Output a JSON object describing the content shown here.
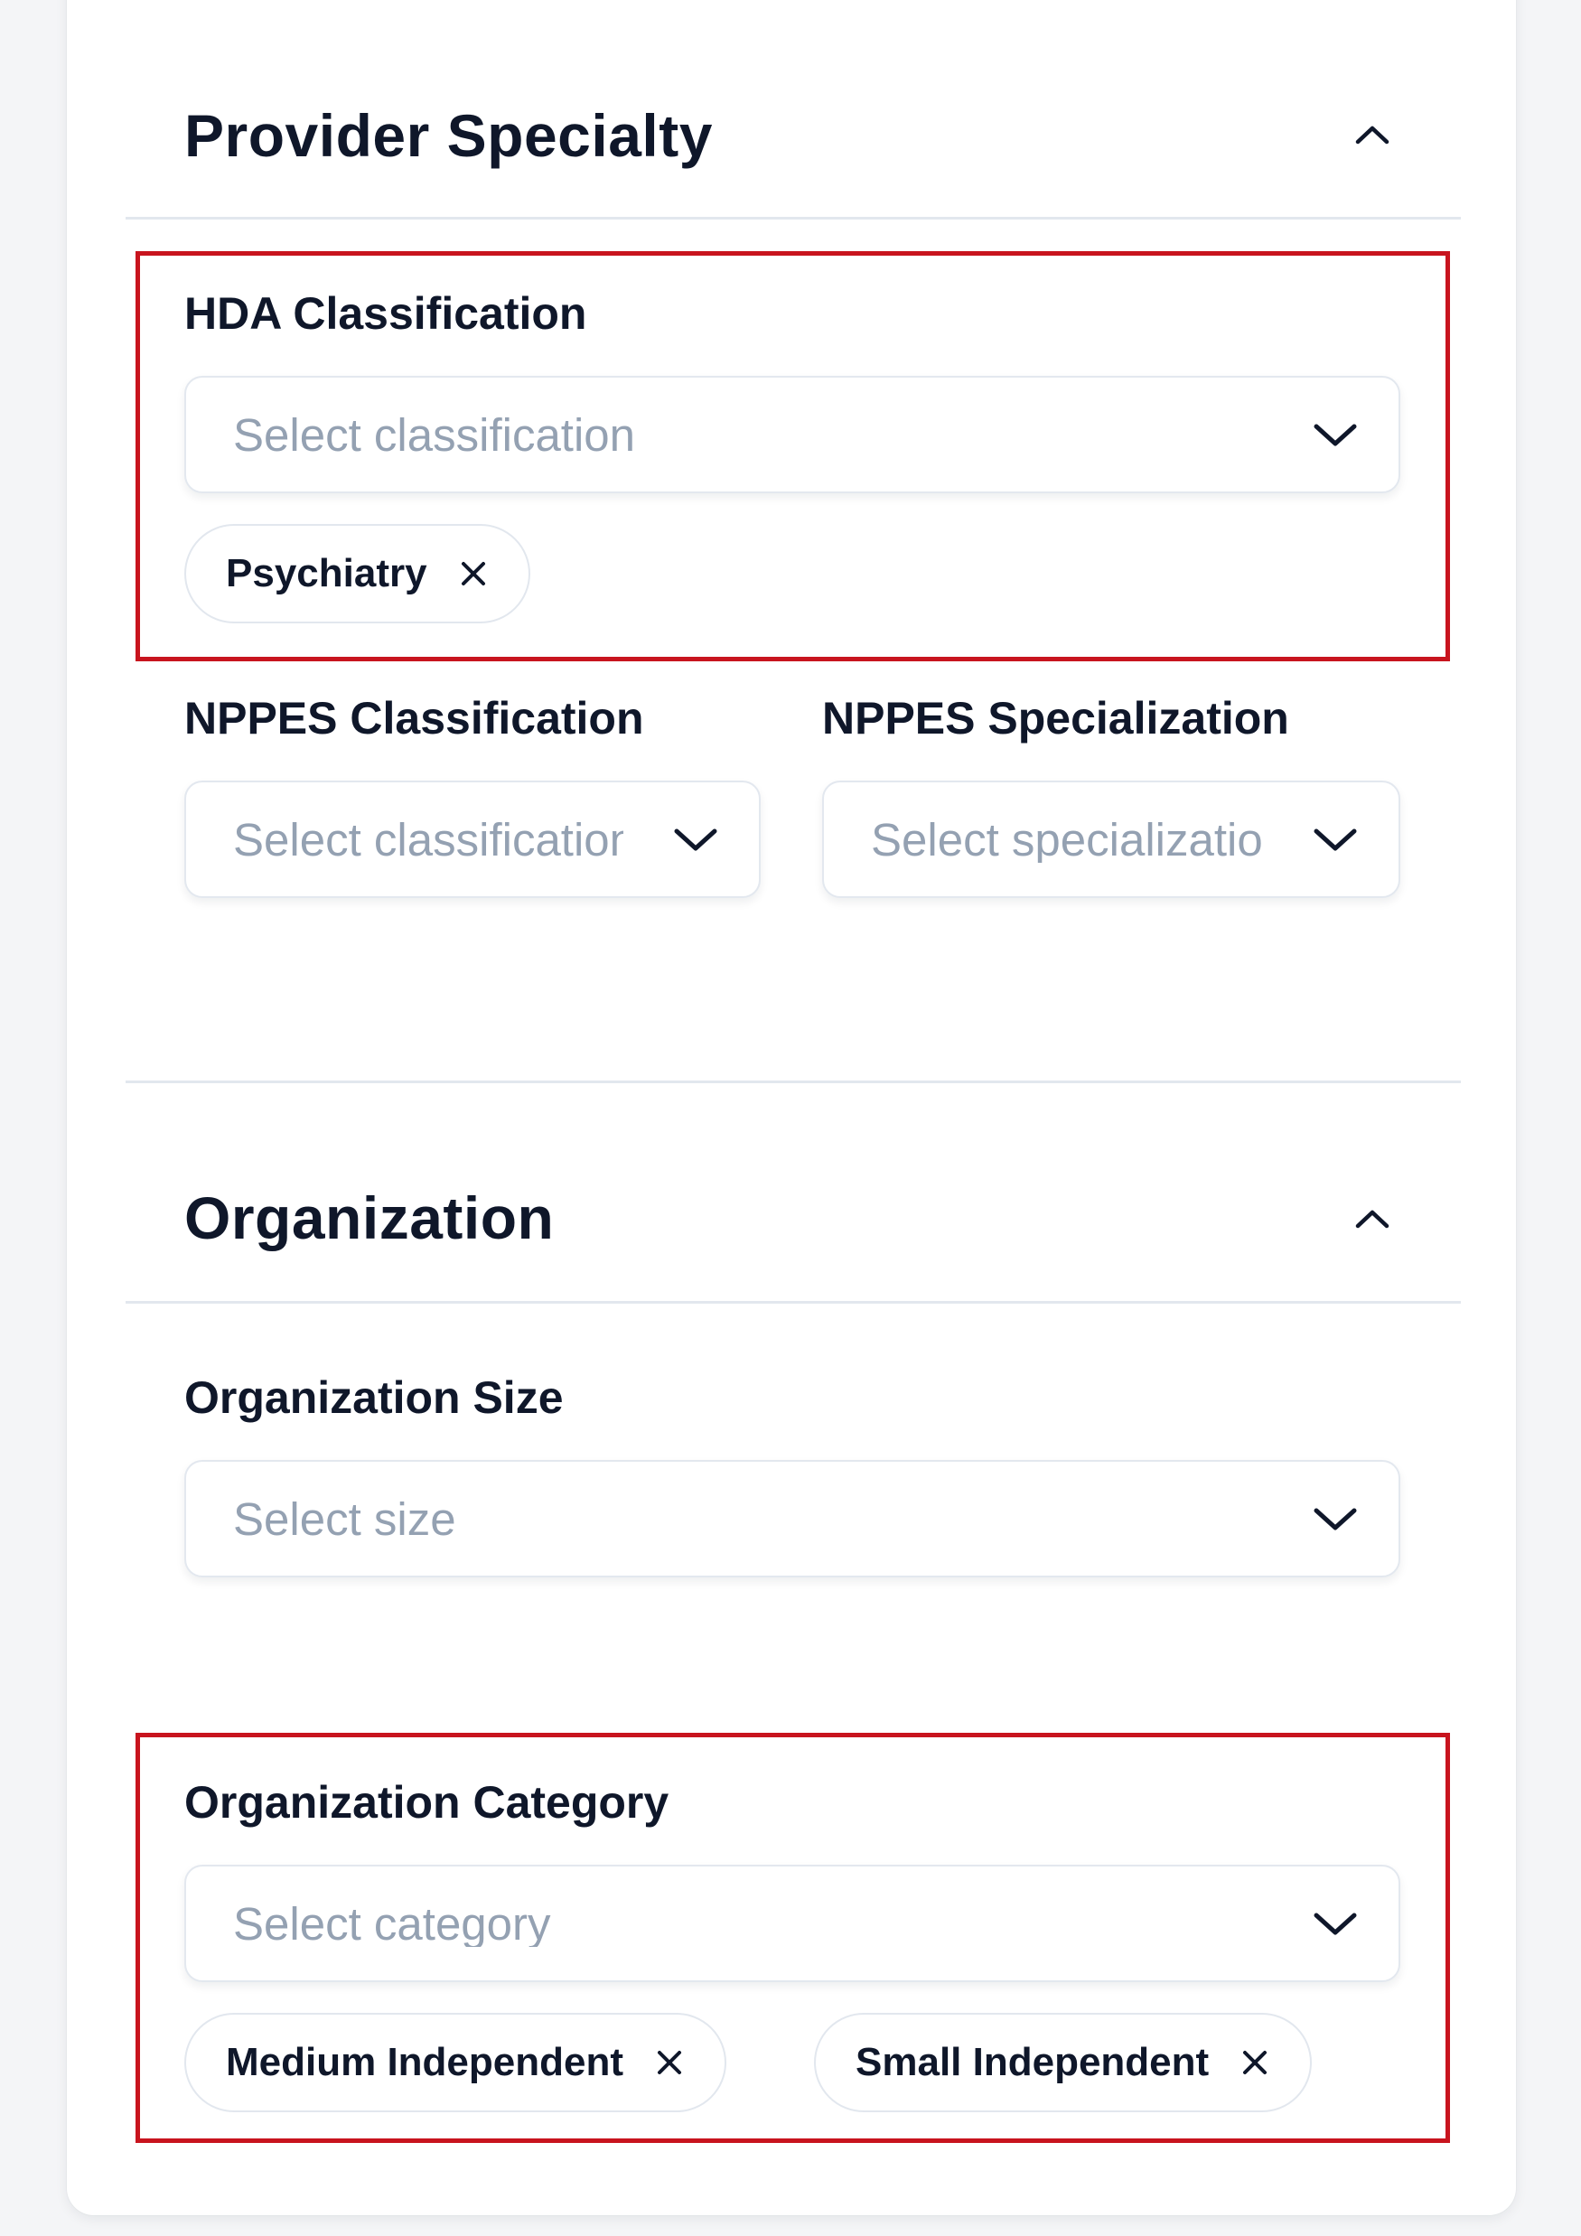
{
  "provider_specialty": {
    "title": "Provider Specialty",
    "hda_classification": {
      "label": "HDA Classification",
      "placeholder": "Select classification",
      "chips": [
        "Psychiatry"
      ]
    },
    "nppes_classification": {
      "label": "NPPES Classification",
      "placeholder": "Select classification"
    },
    "nppes_specialization": {
      "label": "NPPES Specialization",
      "placeholder": "Select specialization"
    }
  },
  "organization": {
    "title": "Organization",
    "size": {
      "label": "Organization Size",
      "placeholder": "Select size"
    },
    "category": {
      "label": "Organization Category",
      "placeholder": "Select category",
      "chips": [
        "Medium Independent",
        "Small Independent"
      ]
    }
  },
  "highlight_color": "#c8141e"
}
